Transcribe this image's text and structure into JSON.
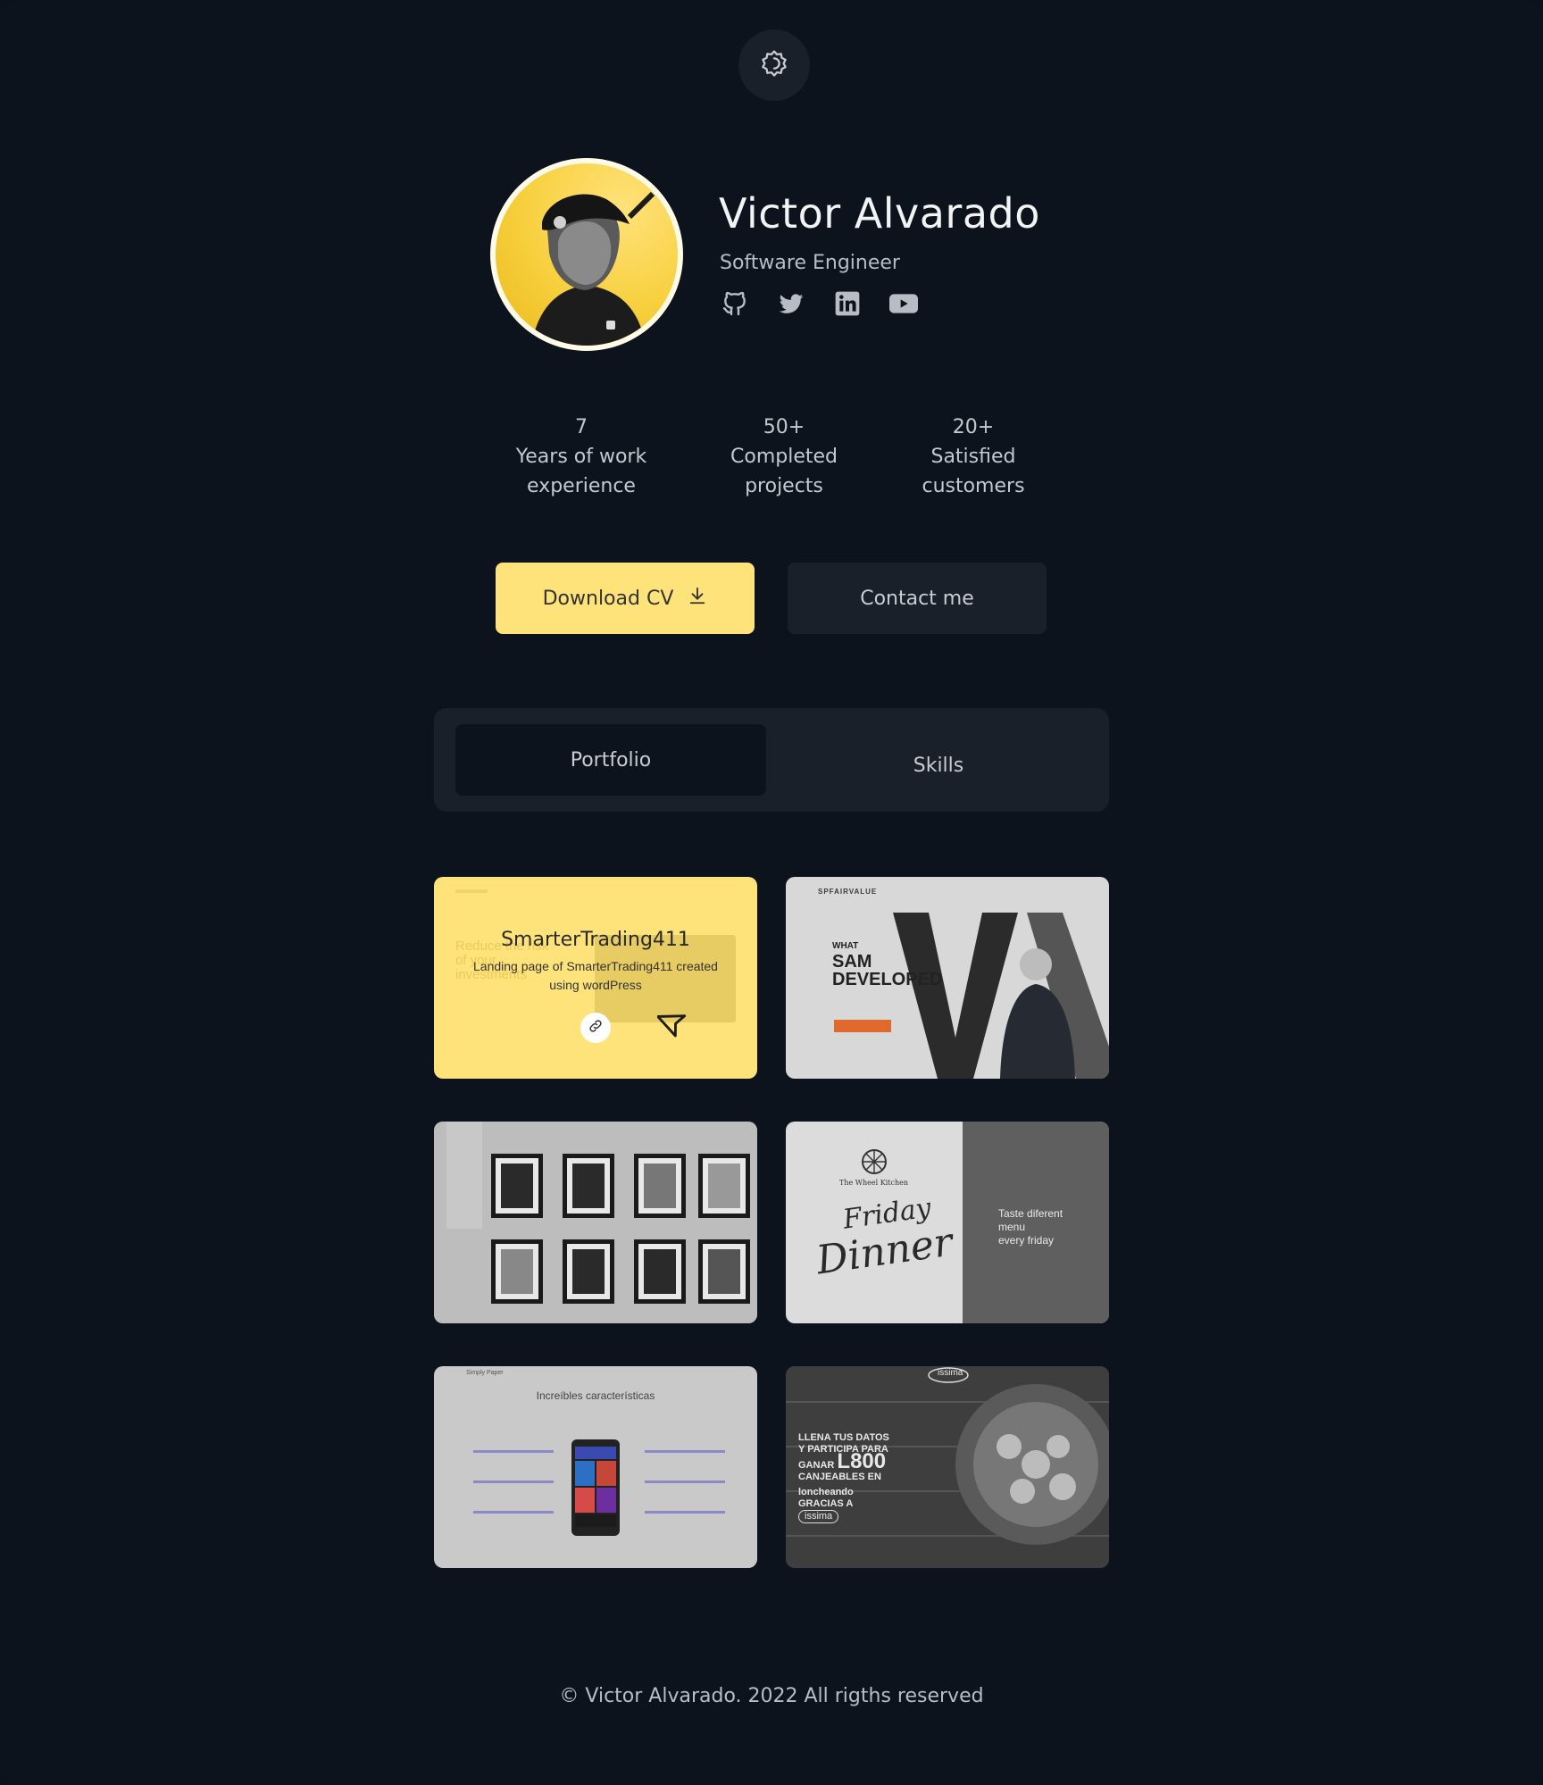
{
  "header": {
    "theme_toggle_icon": "sun-icon"
  },
  "profile": {
    "name": "Victor Alvarado",
    "role": "Software Engineer",
    "socials": [
      {
        "icon": "github-icon"
      },
      {
        "icon": "twitter-icon"
      },
      {
        "icon": "linkedin-icon"
      },
      {
        "icon": "youtube-icon"
      }
    ]
  },
  "stats": [
    {
      "value": "7",
      "label_line1": "Years of work",
      "label_line2": "experience"
    },
    {
      "value": "50+",
      "label_line1": "Completed",
      "label_line2": "projects"
    },
    {
      "value": "20+",
      "label_line1": "Satisfied",
      "label_line2": "customers"
    }
  ],
  "actions": {
    "download_cv": "Download CV",
    "download_icon": "download-icon",
    "contact": "Contact me"
  },
  "tabs": [
    {
      "label": "Portfolio",
      "active": true
    },
    {
      "label": "Skills",
      "active": false
    }
  ],
  "portfolio": {
    "cards": [
      {
        "title": "SmarterTrading411",
        "description": "Landing page of SmarterTrading411 created using wordPress",
        "hover": true,
        "link_icon": "link-icon",
        "bg_text": "Reduce the risk of your investments"
      },
      {
        "brand": "SPFAIRVALUE",
        "headline_1": "WHAT",
        "headline_2": "SAM",
        "headline_3": "DEVELOPED"
      },
      {
        "subject": "framed-pictures"
      },
      {
        "brand": "The Wheel Kitchen",
        "script_text_1": "Friday",
        "script_text_2": "Dinner",
        "tagline_1": "Taste diferent",
        "tagline_2": "menu",
        "tagline_3": "every friday"
      },
      {
        "brand": "Simply Paper",
        "heading": "Increíbles características"
      },
      {
        "brand": "issima",
        "promo_1": "LLENA TUS DATOS",
        "promo_2": "Y PARTICIPA PARA",
        "promo_3": "GANAR",
        "promo_4": "L800",
        "promo_5": "CANJEABLES EN",
        "promo_6": "loncheando",
        "promo_7": "GRACIAS A",
        "promo_8": "issima"
      }
    ]
  },
  "footer": {
    "text": "© Victor Alvarado. 2022 All rigths reserved"
  },
  "colors": {
    "background": "#0d131d",
    "panel": "#1a2029",
    "accent": "#fde379"
  }
}
